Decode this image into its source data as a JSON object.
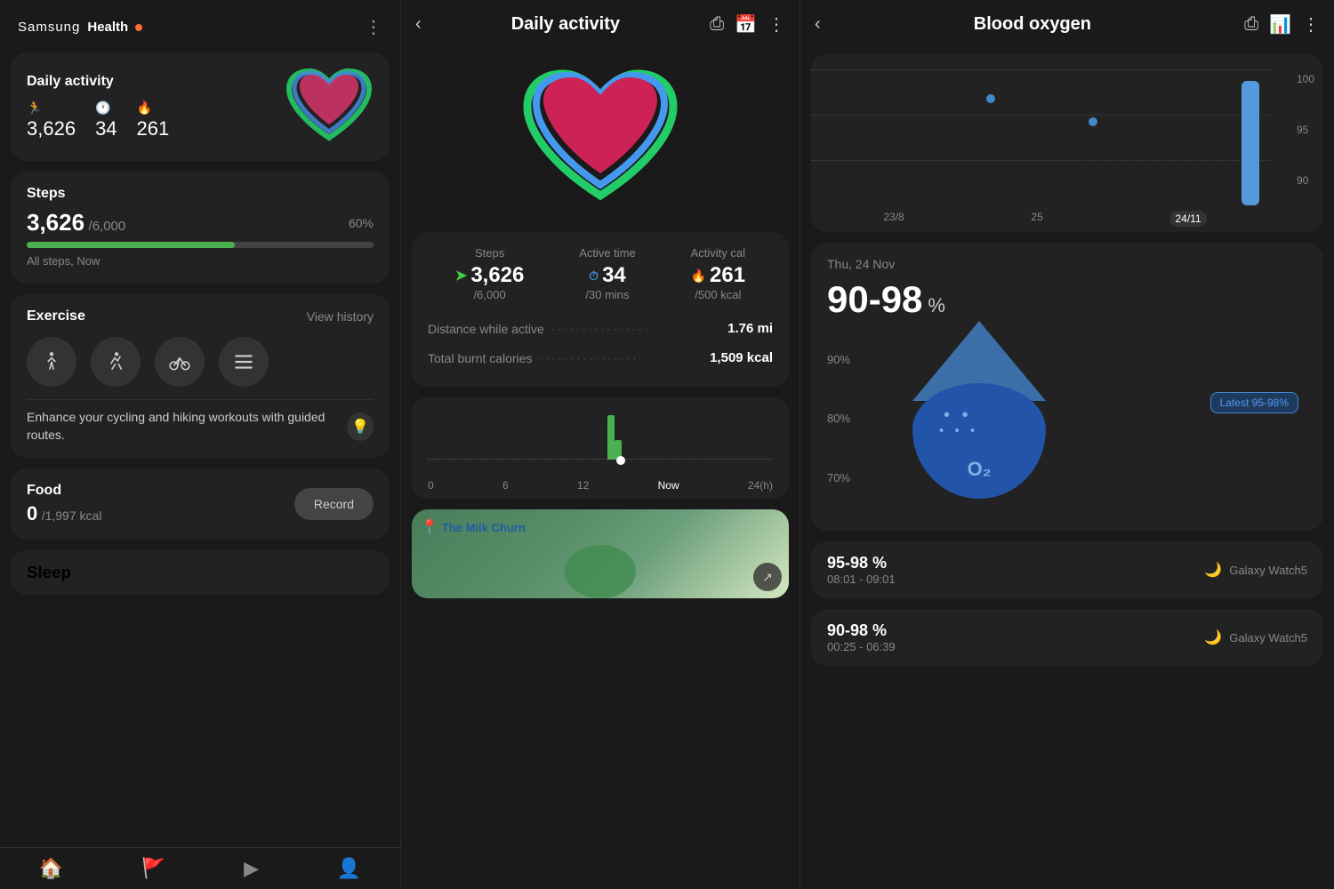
{
  "app": {
    "name": "Samsung",
    "health": "Health",
    "notification_dot": true
  },
  "left": {
    "header": {
      "more_label": "⋮"
    },
    "daily_activity": {
      "title": "Daily activity",
      "steps_icon": "🏃",
      "steps_value": "3,626",
      "active_icon": "🕐",
      "active_value": "34",
      "cal_icon": "🔥",
      "cal_value": "261"
    },
    "steps": {
      "title": "Steps",
      "value": "3,626",
      "goal": "/6,000",
      "percent": "60%",
      "subtitle": "All steps, Now",
      "fill_width": "60%"
    },
    "exercise": {
      "title": "Exercise",
      "view_history": "View history",
      "tip": "Enhance your cycling and hiking workouts with guided routes."
    },
    "food": {
      "title": "Food",
      "value": "0",
      "goal": "/1,997 kcal",
      "record_label": "Record"
    },
    "sleep": {
      "title": "Sleep"
    },
    "nav": {
      "home": "🏠",
      "flag": "🚩",
      "play": "▶",
      "person": "👤"
    }
  },
  "middle": {
    "header": {
      "title": "Daily activity",
      "back": "‹",
      "share": "share-icon",
      "calendar": "calendar-icon",
      "more": "⋮"
    },
    "stats": {
      "steps_label": "Steps",
      "steps_value": "3,626",
      "steps_subvalue": "/6,000",
      "active_label": "Active time",
      "active_value": "34",
      "active_subvalue": "/30 mins",
      "cal_label": "Activity cal",
      "cal_value": "261",
      "cal_subvalue": "/500 kcal"
    },
    "distance": {
      "label": "Distance while active",
      "value": "1.76 mi"
    },
    "total_cal": {
      "label": "Total burnt calories",
      "value": "1,509 kcal"
    },
    "chart": {
      "labels": [
        "0",
        "6",
        "12",
        "Now",
        "24(h)"
      ]
    },
    "map": {
      "location": "The Milk Churn"
    }
  },
  "right": {
    "header": {
      "title": "Blood oxygen",
      "back": "‹",
      "share": "share-icon",
      "bars": "bars-icon",
      "more": "⋮"
    },
    "chart": {
      "y_labels": [
        "100",
        "95",
        "90"
      ],
      "x_labels": [
        "23/8",
        "25",
        "24/11"
      ]
    },
    "main": {
      "date": "Thu, 24 Nov",
      "range": "90-98",
      "percent": "%",
      "latest_label": "Latest 95-98%",
      "y_labels": [
        "90%",
        "80%",
        "70%"
      ]
    },
    "records": [
      {
        "range": "95-98 %",
        "time": "08:01 - 09:01",
        "device": "Galaxy Watch5",
        "icon": "🌙"
      },
      {
        "range": "90-98 %",
        "time": "00:25 - 06:39",
        "device": "Galaxy Watch5",
        "icon": "🌙"
      }
    ]
  }
}
